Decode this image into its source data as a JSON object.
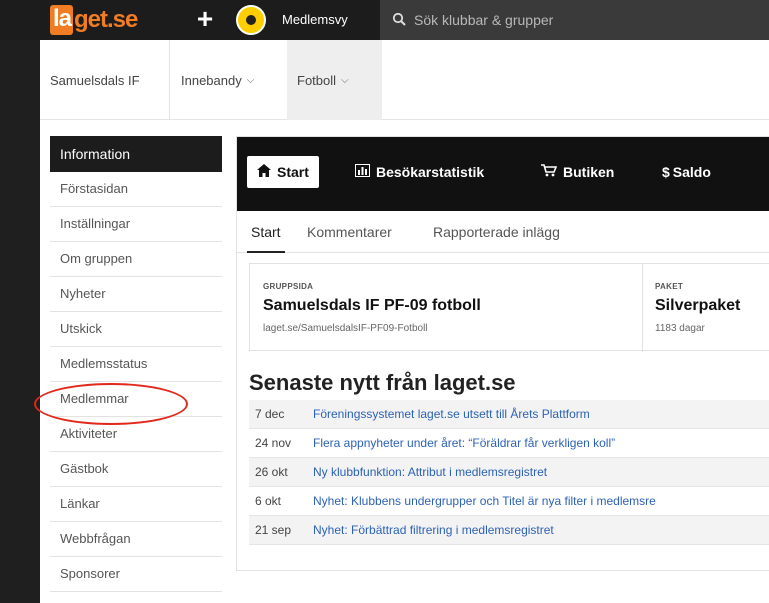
{
  "topbar": {
    "logo": {
      "part1": "la",
      "part2": "get",
      "part3": ".se"
    },
    "plus_icon": "plus-icon",
    "club_badge_icon": "club-badge-icon",
    "member_view_label": "Medlemsvy",
    "search_placeholder": "Sök klubbar & grupper"
  },
  "subnav": {
    "tabs": [
      {
        "label": "Samuelsdals IF"
      },
      {
        "label": "Innebandy"
      },
      {
        "label": "Fotboll"
      }
    ]
  },
  "sidebar": {
    "header": "Information",
    "items": [
      {
        "label": "Förstasidan"
      },
      {
        "label": "Inställningar"
      },
      {
        "label": "Om gruppen"
      },
      {
        "label": "Nyheter"
      },
      {
        "label": "Utskick"
      },
      {
        "label": "Medlemsstatus"
      },
      {
        "label": "Medlemmar"
      },
      {
        "label": "Aktiviteter"
      },
      {
        "label": "Gästbok"
      },
      {
        "label": "Länkar"
      },
      {
        "label": "Webbfrågan"
      },
      {
        "label": "Sponsorer"
      }
    ]
  },
  "toolbar": {
    "buttons": [
      {
        "label": "Start",
        "icon": "home-icon"
      },
      {
        "label": "Besökarstatistik",
        "icon": "bar-chart-icon"
      },
      {
        "label": "Butiken",
        "icon": "cart-icon"
      },
      {
        "label": "Saldo",
        "icon": "dollar-icon"
      }
    ]
  },
  "tabs": [
    {
      "label": "Start"
    },
    {
      "label": "Kommentarer"
    },
    {
      "label": "Rapporterade inlägg"
    }
  ],
  "info": {
    "group": {
      "label": "GRUPPSIDA",
      "title": "Samuelsdals IF PF-09 fotboll",
      "sub": "laget.se/SamuelsdalsIF-PF09-Fotboll"
    },
    "package": {
      "label": "PAKET",
      "title": "Silverpaket",
      "sub": "1183 dagar"
    }
  },
  "news": {
    "title": "Senaste nytt från laget.se",
    "items": [
      {
        "date": "7 dec",
        "text": "Föreningssystemet laget.se utsett till Årets Plattform"
      },
      {
        "date": "24 nov",
        "text": "Flera appnyheter under året: “Föräldrar får verkligen koll”"
      },
      {
        "date": "26 okt",
        "text": "Ny klubbfunktion: Attribut i medlemsregistret"
      },
      {
        "date": "6 okt",
        "text": "Nyhet: Klubbens undergrupper och Titel är nya filter i medlemsre"
      },
      {
        "date": "21 sep",
        "text": "Nyhet: Förbättrad filtrering i medlemsregistret"
      }
    ]
  },
  "colors": {
    "brand": "#f07c24",
    "highlight_circle": "#e2281b",
    "link": "#2d62b5"
  }
}
